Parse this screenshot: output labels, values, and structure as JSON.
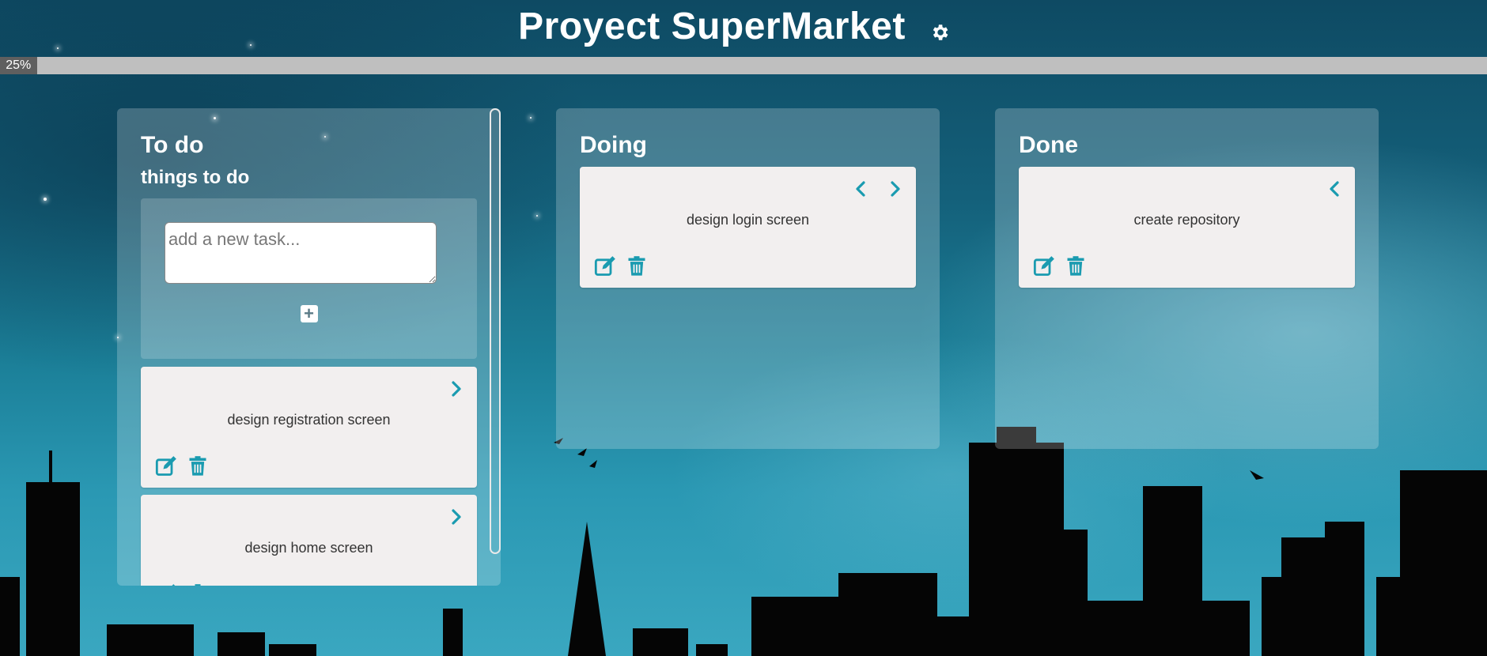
{
  "header": {
    "title": "Proyect SuperMarket",
    "gear_icon": "gear-icon"
  },
  "progress": {
    "percent": 25,
    "label": "25%"
  },
  "columns": [
    {
      "title": "To do",
      "subtitle": "things to do",
      "add_task": {
        "placeholder": "add a new task...",
        "add_icon": "plus-square-icon"
      },
      "cards": [
        {
          "text": "design registration screen",
          "arrows": [
            "chevron-right-icon"
          ]
        },
        {
          "text": "design home screen",
          "arrows": [
            "chevron-right-icon"
          ]
        }
      ]
    },
    {
      "title": "Doing",
      "cards": [
        {
          "text": "design login screen",
          "arrows": [
            "chevron-left-icon",
            "chevron-right-icon"
          ]
        }
      ]
    },
    {
      "title": "Done",
      "cards": [
        {
          "text": "create repository",
          "arrows": [
            "chevron-left-icon"
          ]
        }
      ]
    }
  ],
  "colors": {
    "accent": "#1a9bb0",
    "card_bg": "#f2efef",
    "progress_fill": "#5f5f5f",
    "progress_track": "#bfbfbf"
  }
}
